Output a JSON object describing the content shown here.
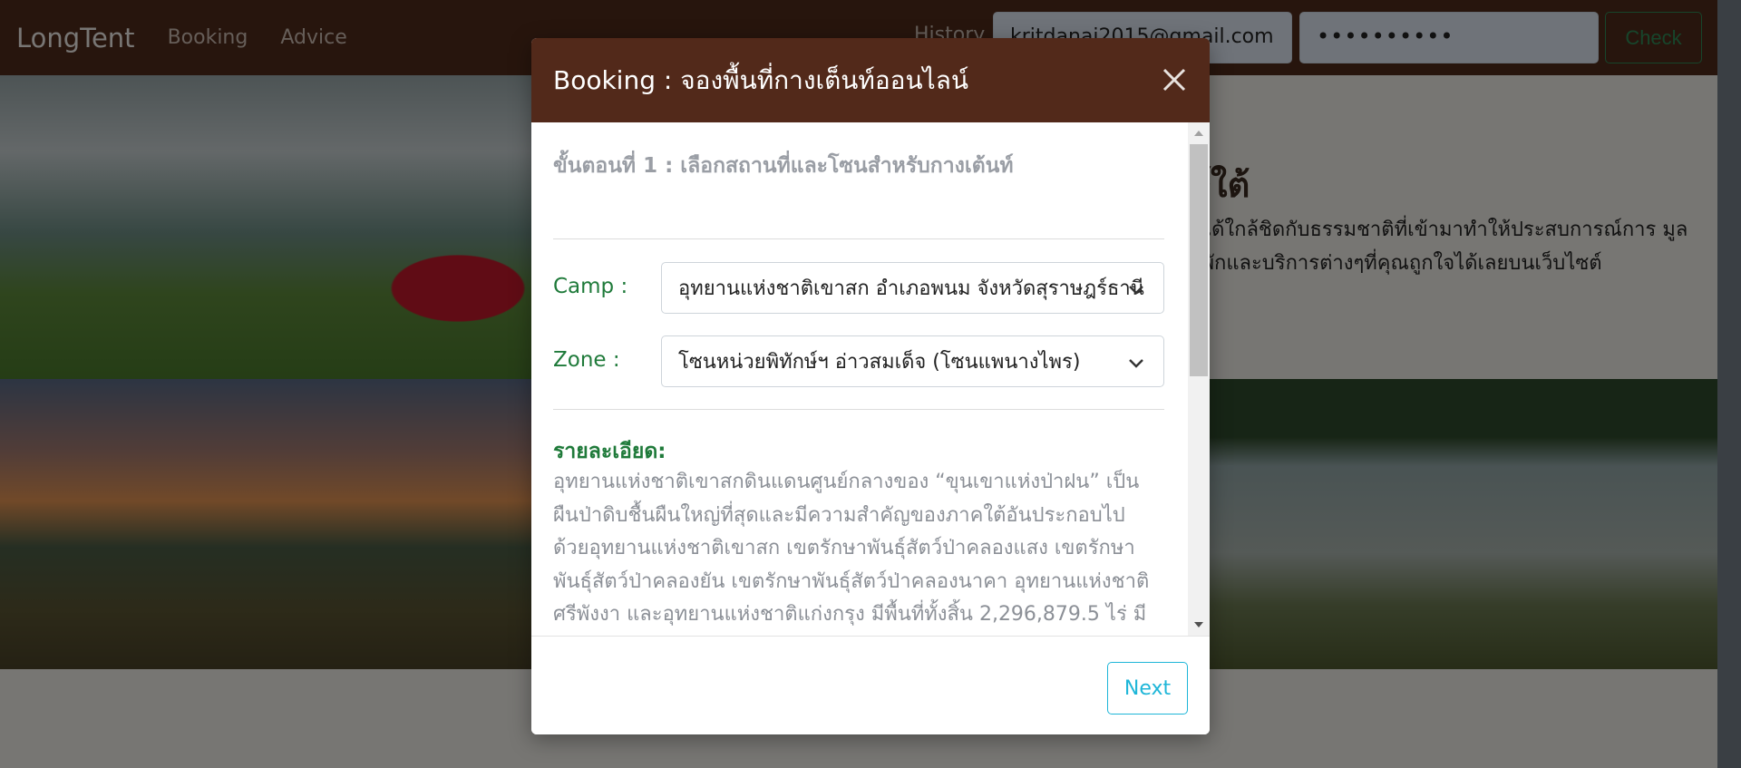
{
  "navbar": {
    "brand": "LongTent",
    "links": [
      "Booking",
      "Advice"
    ],
    "history": "History",
    "email_value": "kritdanai2015@gmail.com",
    "password_value": "••••••••••",
    "check_label": "Check"
  },
  "page": {
    "heading": "ษ์ใต้",
    "paragraph": "นได้ใกล้ชิดกับธรรมชาติที่เข้ามาทำให้ประสบการณ์การ มูลที่พักและบริการต่างๆที่คุณถูกใจได้เลยบนเว็บไซต์"
  },
  "modal": {
    "title": "Booking : จองพื้นที่กางเต็นท์ออนไลน์",
    "step_title": "ขั้นตอนที่ 1 : เลือกสถานที่และโซนสำหรับกางเต้นท์",
    "camp_label": "Camp :",
    "camp_value": "อุทยานแห่งชาติเขาสก อำเภอพนม จังหวัดสุราษฎร์ธานี",
    "zone_label": "Zone :",
    "zone_value": "โซนหน่วยพิทักษ์ฯ อ่าวสมเด็จ (โซนแพนางไพร)",
    "detail_heading": "รายละเอียด:",
    "detail_text": "อุทยานแห่งชาติเขาสกดินแดนศูนย์กลางของ “ขุนเขาแห่งป่าฝน” เป็นผืนป่าดิบชื้นผืนใหญ่ที่สุดและมีความสำคัญของภาคใต้อันประกอบไปด้วยอุทยานแห่งชาติเขาสก เขตรักษาพันธุ์สัตว์ป่าคลองแสง เขตรักษาพันธุ์สัตว์ป่าคลองยัน เขตรักษาพันธุ์สัตว์ป่าคลองนาคา อุทยานแห่งชาติศรีพังงา และอุทยานแห่งชาติแก่งกรุง มีพื้นที่ทั้งสิ้น 2,296,879.5 ไร่ มีความหลากหลายทางชีวภาพสูง อุดมไปด้วยพืชพรรณมากมายหลายชนิด ทั้งพืชพรรณที่หายากและเป็นพืชเฉพาะถิ่น รวมไปถึงชนิดพันธุ์สัตว์ป่า",
    "next_label": "Next"
  },
  "colors": {
    "navbar_bg": "#4f2a1b",
    "modal_header_bg": "#52291a",
    "label_green": "#1f7a3a",
    "next_cyan": "#1eb6d8",
    "check_green": "#2e8b57"
  }
}
